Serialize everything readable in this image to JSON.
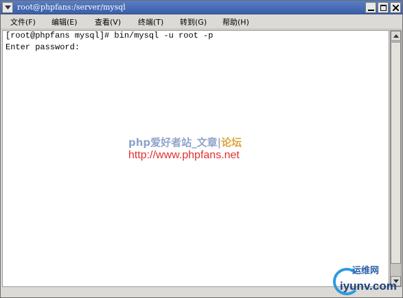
{
  "window": {
    "title": "root@phpfans:/server/mysql"
  },
  "menubar": {
    "items": [
      {
        "label": "文件(F)"
      },
      {
        "label": "编辑(E)"
      },
      {
        "label": "查看(V)"
      },
      {
        "label": "终端(T)"
      },
      {
        "label": "转到(G)"
      },
      {
        "label": "帮助(H)"
      }
    ]
  },
  "terminal": {
    "lines": [
      "[root@phpfans mysql]# bin/mysql -u root -p",
      "Enter password:"
    ]
  },
  "watermark": {
    "title_part1": "php爱好者站_文章",
    "separator": "|",
    "title_part2": "论坛",
    "url": "http://www.phpfans.net"
  },
  "logo": {
    "cn": "运维网",
    "en": "iyunv.com"
  },
  "colors": {
    "titlebar": "#3a5fa8",
    "menubar": "#dcdad5",
    "terminal_bg": "#ffffff",
    "watermark_url": "#e03030",
    "logo_blue": "#2a9be0"
  }
}
